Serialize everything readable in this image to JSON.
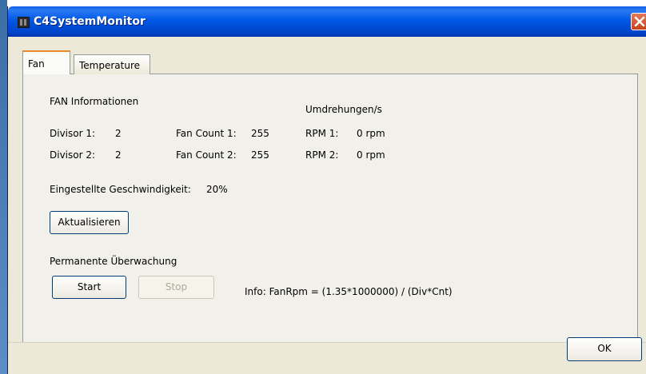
{
  "window": {
    "title": "C4SystemMonitor"
  },
  "tabs": [
    {
      "label": "Fan",
      "active": true
    },
    {
      "label": "Temperature",
      "active": false
    }
  ],
  "fan": {
    "section_title": "FAN Informationen",
    "rpm_header": "Umdrehungen/s",
    "rows": [
      {
        "divisor_label": "Divisor 1:",
        "divisor_value": "2",
        "count_label": "Fan Count 1:",
        "count_value": "255",
        "rpm_label": "RPM 1:",
        "rpm_value": "0 rpm"
      },
      {
        "divisor_label": "Divisor 2:",
        "divisor_value": "2",
        "count_label": "Fan Count 2:",
        "count_value": "255",
        "rpm_label": "RPM 2:",
        "rpm_value": "0 rpm"
      }
    ],
    "speed_label": "Eingestellte Geschwindigkeit:",
    "speed_value": "20%",
    "refresh_button": "Aktualisieren",
    "monitor_title": "Permanente Überwachung",
    "start_button": "Start",
    "stop_button": "Stop",
    "info_text": "Info: FanRpm = (1.35*1000000) / (Div*Cnt)"
  },
  "footer": {
    "ok_button": "OK"
  },
  "colors": {
    "titlebar": "#0058e6",
    "tab_active_accent": "#e68b2c",
    "window_bg": "#ece9d8"
  }
}
